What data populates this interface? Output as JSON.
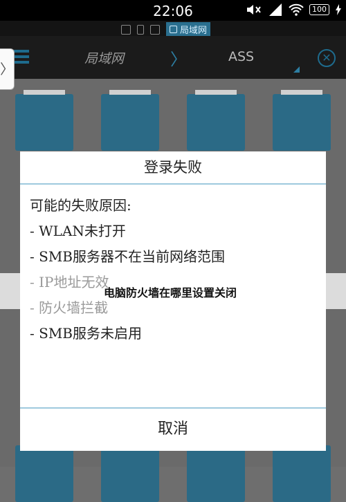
{
  "status_bar": {
    "time": "22:06",
    "battery": "100"
  },
  "toolbar": {
    "crumb_root": "局域网",
    "crumb_sep": "〉",
    "crumb_current": "ASS",
    "close_glyph": "✕"
  },
  "modebar": {
    "lan_label": "局域网"
  },
  "side_tab": {
    "glyph": "〉"
  },
  "dialog": {
    "title": "登录失败",
    "lines": [
      {
        "text": "可能的失败原因:"
      },
      {
        "text": "- WLAN未打开"
      },
      {
        "text": "- SMB服务器不在当前网络范围"
      },
      {
        "text": "- IP地址无效"
      },
      {
        "text": "- 防火墙拦截"
      },
      {
        "text": "- SMB服务未启用"
      }
    ],
    "cancel_label": "取消"
  },
  "watermark": "电脑防火墙在哪里设置关闭",
  "colors": {
    "accent": "#2d7ea2",
    "folder": "#2b6a86",
    "toolbar": "#1b1b1b",
    "divider": "#9ec9de"
  }
}
